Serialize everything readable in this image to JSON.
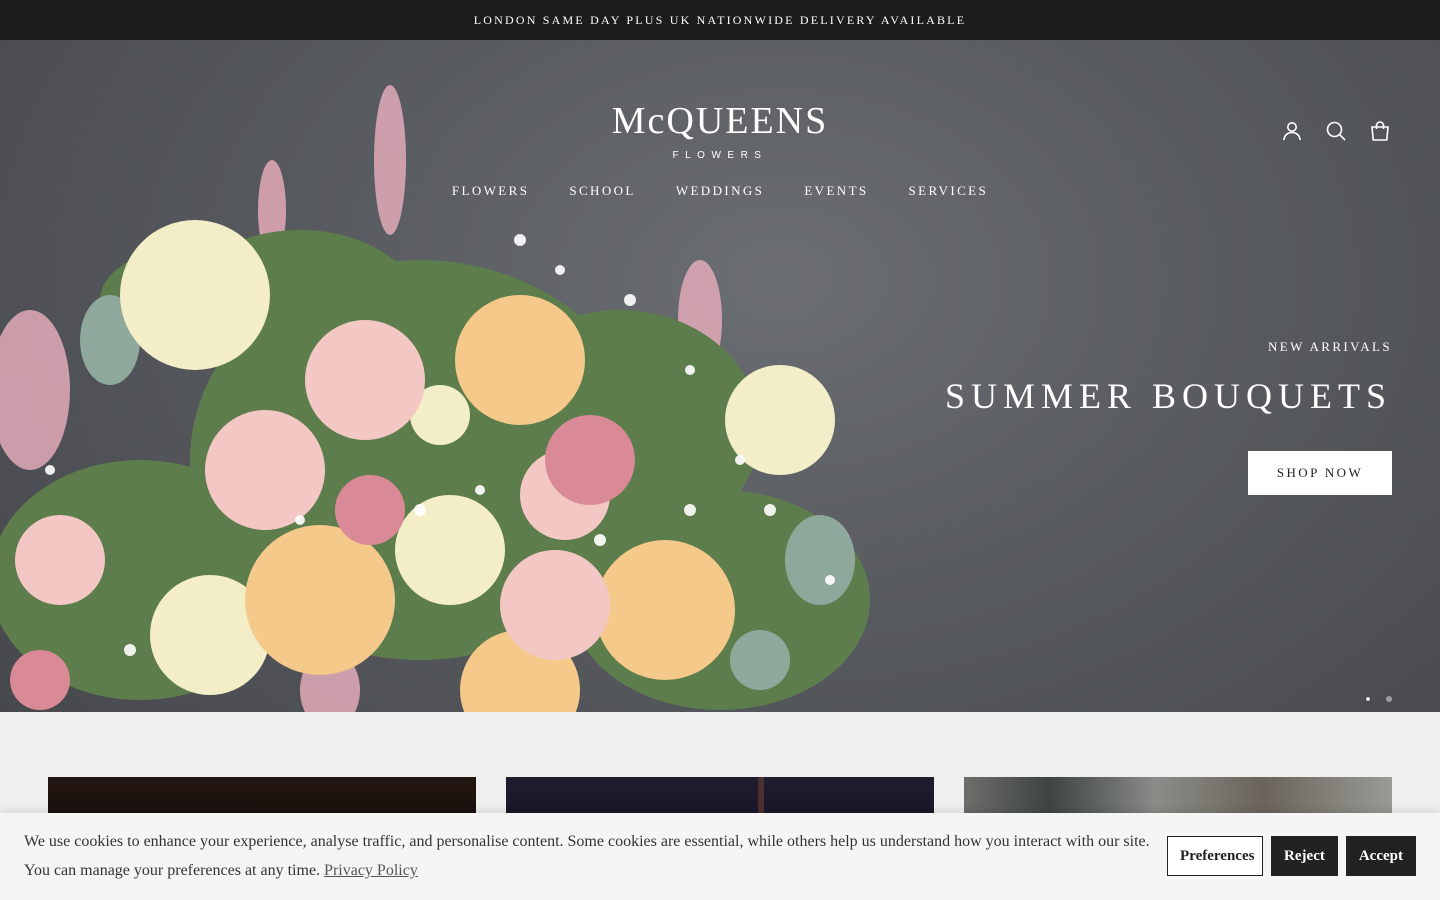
{
  "announcement": "LONDON SAME DAY PLUS UK NATIONWIDE DELIVERY AVAILABLE",
  "brand": {
    "name": "McQUEENS",
    "tagline": "FLOWERS"
  },
  "header_icons": [
    "account-icon",
    "search-icon",
    "cart-icon"
  ],
  "nav": [
    {
      "label": "FLOWERS"
    },
    {
      "label": "SCHOOL"
    },
    {
      "label": "WEDDINGS"
    },
    {
      "label": "EVENTS"
    },
    {
      "label": "SERVICES"
    }
  ],
  "hero": {
    "eyebrow": "NEW ARRIVALS",
    "title": "SUMMER BOUQUETS",
    "cta": "SHOP NOW",
    "slides": 2,
    "active_slide": 1
  },
  "cookie": {
    "line1": "We use cookies to enhance your experience, analyse traffic, and personalise content. Some cookies are essential, while others help us understand how you interact with our site.",
    "line2": "You can manage your preferences at any time.",
    "link": "Privacy Policy",
    "buttons": {
      "preferences": "Preferences",
      "reject": "Reject",
      "accept": "Accept"
    }
  },
  "colors": {
    "announcement_bg": "#1c1c1c",
    "hero_bg": "#585b60",
    "page_bg": "#efefef",
    "button_dark": "#222222"
  }
}
